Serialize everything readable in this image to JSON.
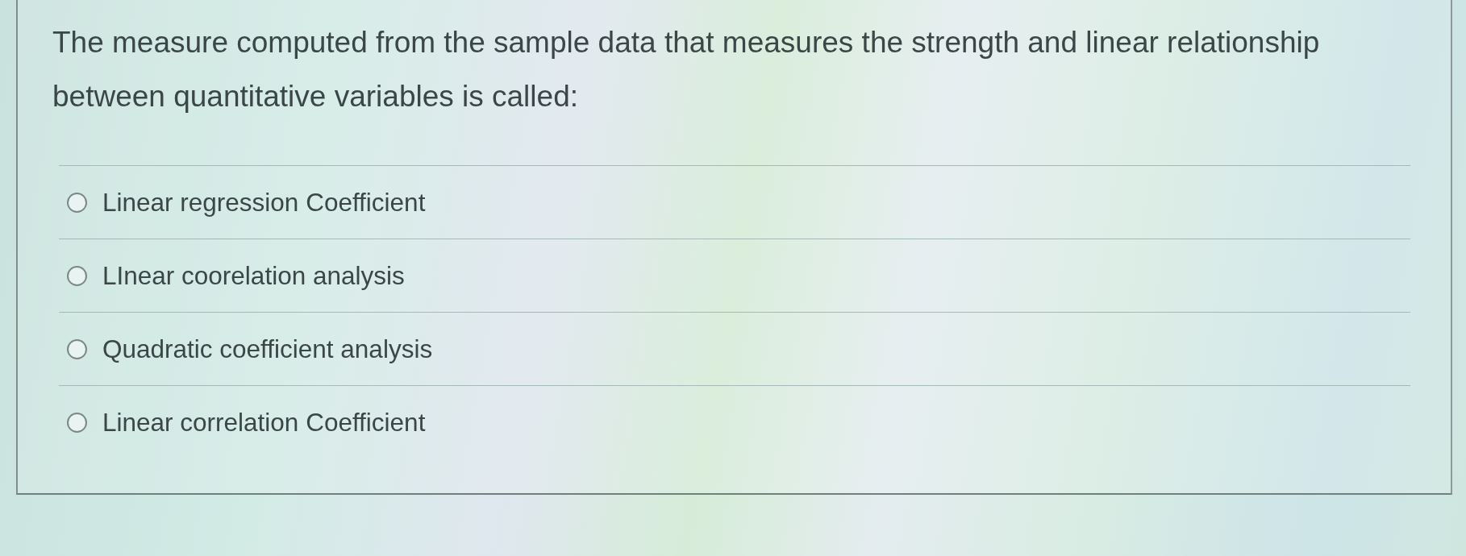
{
  "question": {
    "text": "The measure computed from the sample data that measures the strength and linear relationship between quantitative variables is called:"
  },
  "options": [
    {
      "label": "Linear regression Coefficient",
      "selected": false
    },
    {
      "label": "LInear coorelation analysis",
      "selected": false
    },
    {
      "label": "Quadratic coefficient analysis",
      "selected": false
    },
    {
      "label": "Linear correlation Coefficient",
      "selected": false
    }
  ]
}
